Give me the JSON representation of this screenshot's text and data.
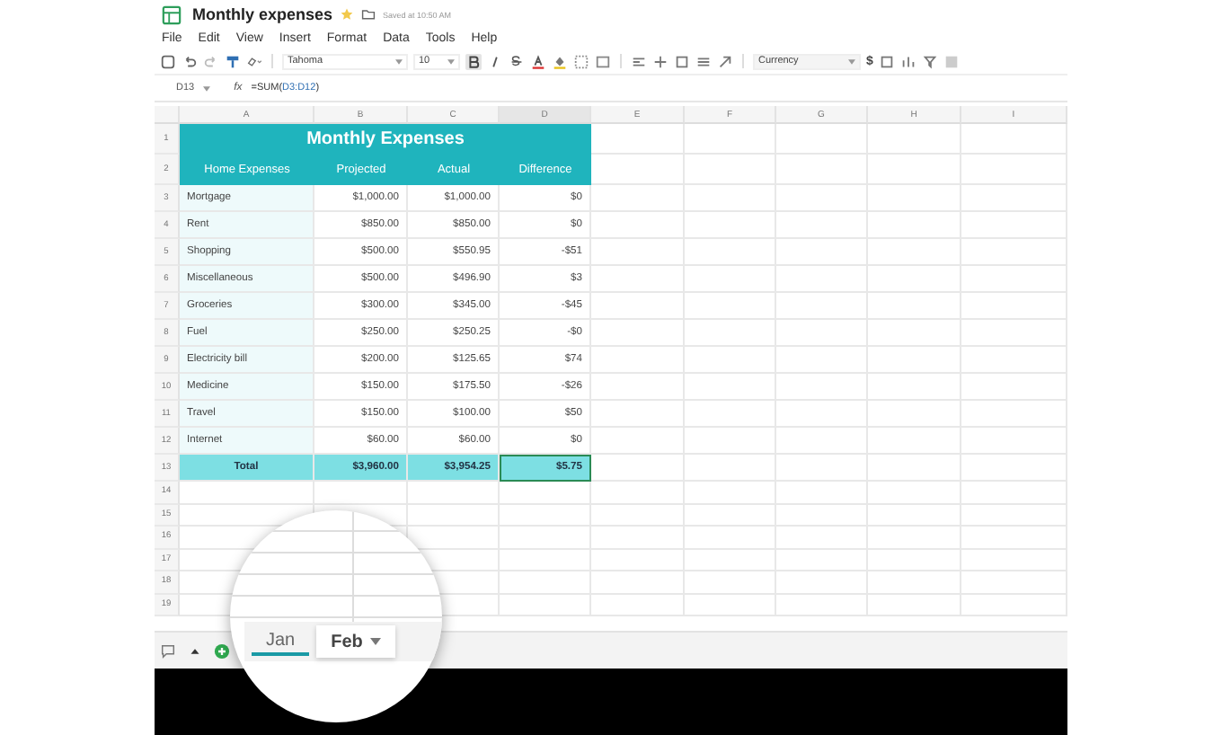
{
  "title": "Monthly expenses",
  "saved_status": "Saved at 10:50 AM",
  "menu": [
    "File",
    "Edit",
    "View",
    "Insert",
    "Format",
    "Data",
    "Tools",
    "Help"
  ],
  "toolbar": {
    "font": "Tahoma",
    "font_size": "10",
    "number_format": "Currency",
    "currency_symbol": "$"
  },
  "formula_bar": {
    "cell_ref": "D13",
    "fx": "fx",
    "formula_start": "=SUM(",
    "formula_range": "D3:D12",
    "formula_end": ")"
  },
  "columns": [
    {
      "label": "A",
      "selected": false
    },
    {
      "label": "B",
      "selected": false
    },
    {
      "label": "C",
      "selected": false
    },
    {
      "label": "D",
      "selected": true
    },
    {
      "label": "E",
      "selected": false
    },
    {
      "label": "F",
      "selected": false
    },
    {
      "label": "G",
      "selected": false
    },
    {
      "label": "H",
      "selected": false
    },
    {
      "label": "I",
      "selected": false
    }
  ],
  "row_numbers": [
    "1",
    "2",
    "3",
    "4",
    "5",
    "6",
    "7",
    "8",
    "9",
    "10",
    "11",
    "12",
    "13",
    "14",
    "15",
    "16",
    "17",
    "18",
    "19"
  ],
  "table_title": "Monthly Expenses",
  "headers": [
    "Home Expenses",
    "Projected",
    "Actual",
    "Difference"
  ],
  "rows": [
    {
      "name": "Mortgage",
      "projected": "$1,000.00",
      "actual": "$1,000.00",
      "difference": "$0"
    },
    {
      "name": "Rent",
      "projected": "$850.00",
      "actual": "$850.00",
      "difference": "$0"
    },
    {
      "name": "Shopping",
      "projected": "$500.00",
      "actual": "$550.95",
      "difference": "-$51"
    },
    {
      "name": "Miscellaneous",
      "projected": "$500.00",
      "actual": "$496.90",
      "difference": "$3"
    },
    {
      "name": "Groceries",
      "projected": "$300.00",
      "actual": "$345.00",
      "difference": "-$45"
    },
    {
      "name": "Fuel",
      "projected": "$250.00",
      "actual": "$250.25",
      "difference": "-$0"
    },
    {
      "name": "Electricity bill",
      "projected": "$200.00",
      "actual": "$125.65",
      "difference": "$74"
    },
    {
      "name": "Medicine",
      "projected": "$150.00",
      "actual": "$175.50",
      "difference": "-$26"
    },
    {
      "name": "Travel",
      "projected": "$150.00",
      "actual": "$100.00",
      "difference": "$50"
    },
    {
      "name": "Internet",
      "projected": "$60.00",
      "actual": "$60.00",
      "difference": "$0"
    }
  ],
  "total": {
    "label": "Total",
    "projected": "$3,960.00",
    "actual": "$3,954.25",
    "difference": "$5.75",
    "difference_selected": true
  },
  "sheet_tabs": [
    {
      "label": "Jan",
      "selected": true
    },
    {
      "label": "Feb",
      "selected": false
    }
  ]
}
